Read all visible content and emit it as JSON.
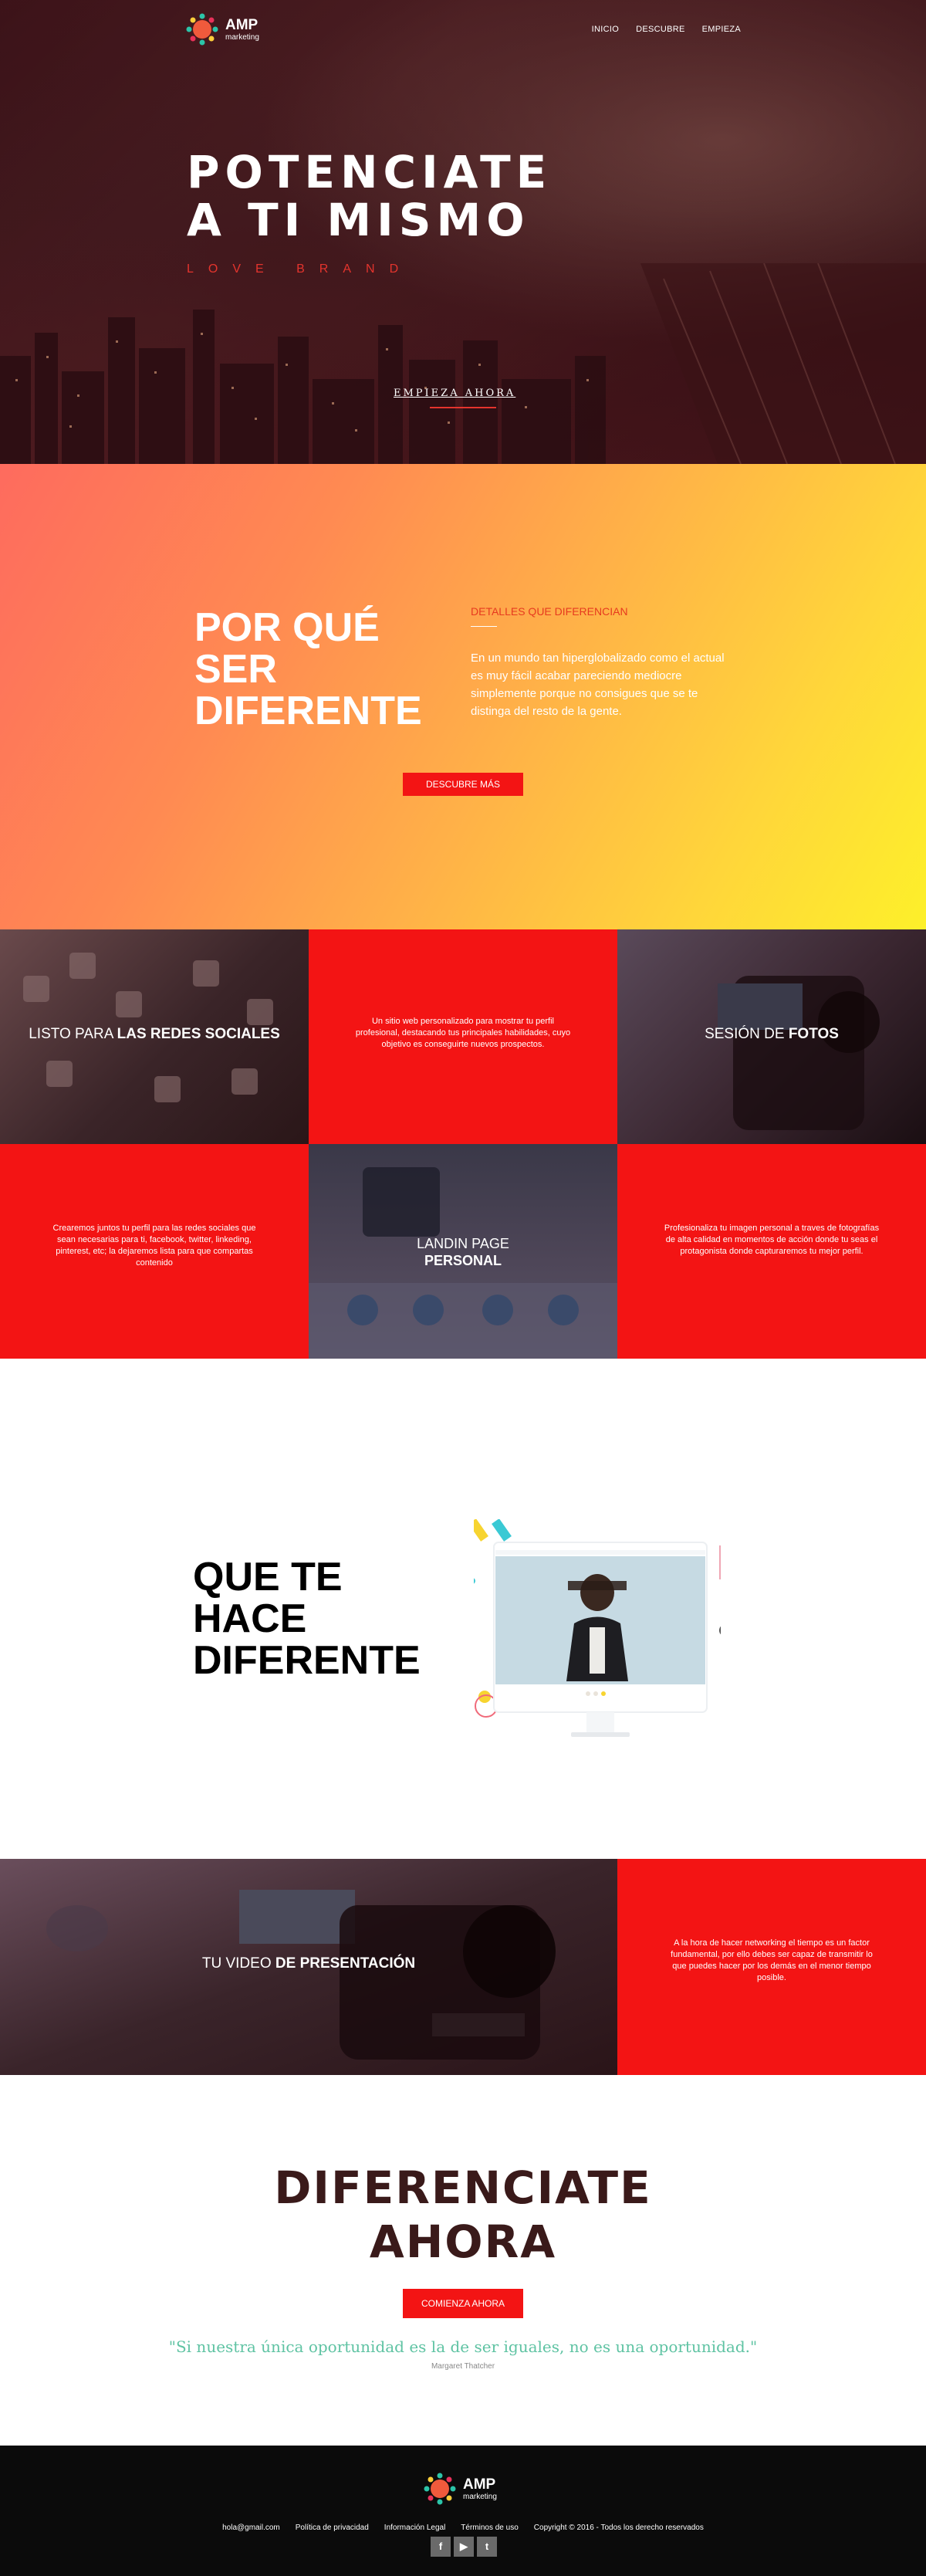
{
  "brand": {
    "name": "AMP",
    "tagline": "marketing"
  },
  "nav": {
    "items": [
      "INICIO",
      "DESCUBRE",
      "EMPIEZA"
    ]
  },
  "hero": {
    "title_line1": "POTENCIATE",
    "title_line2": "A TI MISMO",
    "subtitle": "LOVE BRAND",
    "cta": "EMPIEZA AHORA"
  },
  "why": {
    "title_line1": "POR QUÉ",
    "title_line2": "SER",
    "title_line3": "DIFERENTE",
    "label": "DETALLES QUE DIFERENCIAN",
    "text": "En un mundo tan hiperglobalizado como el actual es muy fácil acabar pareciendo mediocre simplemente porque no consigues que se te distinga del resto de la gente.",
    "button": "DESCUBRE MÁS"
  },
  "grid": {
    "social_caption_light": "LISTO PARA ",
    "social_caption_bold": "LAS REDES SOCIALES",
    "web_text": "Un sitio web personalizado para mostrar tu perfil profesional, destacando tus principales habilidades, cuyo objetivo es conseguirte nuevos prospectos.",
    "photo_caption_light": "SESIÓN DE ",
    "photo_caption_bold": "FOTOS",
    "social_text": "Crearemos juntos tu perfil para las redes sociales que sean necesarias para ti, facebook, twitter, linkeding, pinterest, etc; la dejaremos lista para que compartas contenido",
    "landing_caption_line1": "LANDIN PAGE",
    "landing_caption_line2": "PERSONAL",
    "photo_text": "Profesionaliza tu imagen personal a traves de fotografías de alta calidad en momentos de acción donde tu seas el protagonista donde capturaremos tu mejor perfil."
  },
  "different": {
    "title_line1": "QUE TE",
    "title_line2": "HACE",
    "title_line3": "DIFERENTE"
  },
  "video": {
    "caption_light": "TU VIDEO ",
    "caption_bold": "DE PRESENTACIÓN",
    "text": "A la hora de hacer networking el tiempo es un factor fundamental, por ello debes ser capaz de transmitir lo que puedes hacer por los demás en el menor tiempo posible."
  },
  "cta": {
    "title_line1": "DIFERENCIATE",
    "title_line2": "AHORA",
    "button": "COMIENZA AHORA",
    "quote": "\"Si nuestra única oportunidad es la de ser iguales, no es una oportunidad.\"",
    "author": "Margaret Thatcher"
  },
  "footer": {
    "email": "hola@gmail.com",
    "privacy": "Política de privacidad",
    "legal": "Información Legal",
    "terms": "Términos de uso",
    "copyright": "Copyright © 2016 - Todos los derecho reservados",
    "social": [
      "f",
      "yt",
      "tw"
    ]
  },
  "colors": {
    "accent_red": "#f31414",
    "quote_green": "#5fc3a3",
    "footer_bg": "#0b0b0b"
  }
}
